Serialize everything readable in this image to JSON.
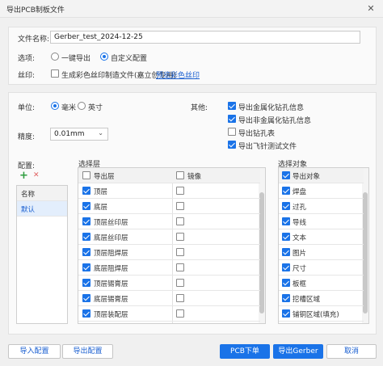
{
  "window": {
    "title": "导出PCB制板文件",
    "close_glyph": "✕"
  },
  "file": {
    "name_label": "文件名称:",
    "name_value": "Gerber_test_2024-12-25",
    "options_label": "选项:",
    "option_quick": "一键导出",
    "option_custom": "自定义配置",
    "silk_label": "丝印:",
    "silk_text": "生成彩色丝印制造文件(嘉立创专用)",
    "silk_link": "预览彩色丝印"
  },
  "settings": {
    "unit_label": "单位:",
    "unit_mm": "毫米",
    "unit_inch": "英寸",
    "precision_label": "精度:",
    "precision_value": "0.01mm",
    "other_label": "其他:",
    "other_options": [
      {
        "label": "导出金属化钻孔信息",
        "checked": true
      },
      {
        "label": "导出非金属化钻孔信息",
        "checked": true
      },
      {
        "label": "导出钻孔表",
        "checked": false
      },
      {
        "label": "导出飞针测试文件",
        "checked": true
      }
    ]
  },
  "config": {
    "label": "配置:",
    "add_icon": "+",
    "delete_icon": "✕",
    "header": "名称",
    "items": [
      "默认"
    ]
  },
  "layers": {
    "label": "选择层",
    "col_export": "导出层",
    "col_mirror": "镜像",
    "rows": [
      {
        "name": "顶层",
        "checked": true
      },
      {
        "name": "底层",
        "checked": true
      },
      {
        "name": "顶层丝印层",
        "checked": true
      },
      {
        "name": "底层丝印层",
        "checked": true
      },
      {
        "name": "顶层阻焊层",
        "checked": true
      },
      {
        "name": "底层阻焊层",
        "checked": true
      },
      {
        "name": "顶层锡膏层",
        "checked": true
      },
      {
        "name": "底层锡膏层",
        "checked": true
      },
      {
        "name": "顶层装配层",
        "checked": true
      }
    ]
  },
  "objects": {
    "label": "选择对象",
    "col_export": "导出对象",
    "rows": [
      {
        "name": "焊盘",
        "checked": true
      },
      {
        "name": "过孔",
        "checked": true
      },
      {
        "name": "导线",
        "checked": true
      },
      {
        "name": "文本",
        "checked": true
      },
      {
        "name": "图片",
        "checked": true
      },
      {
        "name": "尺寸",
        "checked": true
      },
      {
        "name": "板框",
        "checked": true
      },
      {
        "name": "挖槽区域",
        "checked": true
      },
      {
        "name": "铺铜区域(填充)",
        "checked": true
      }
    ]
  },
  "footer": {
    "import_config": "导入配置",
    "export_config": "导出配置",
    "pcb_order": "PCB下单",
    "export_gerber": "导出Gerber",
    "cancel": "取消"
  },
  "colors": {
    "accent": "#1a73e8",
    "delete_red": "#e53935",
    "add_green": "#2e9d3f"
  }
}
